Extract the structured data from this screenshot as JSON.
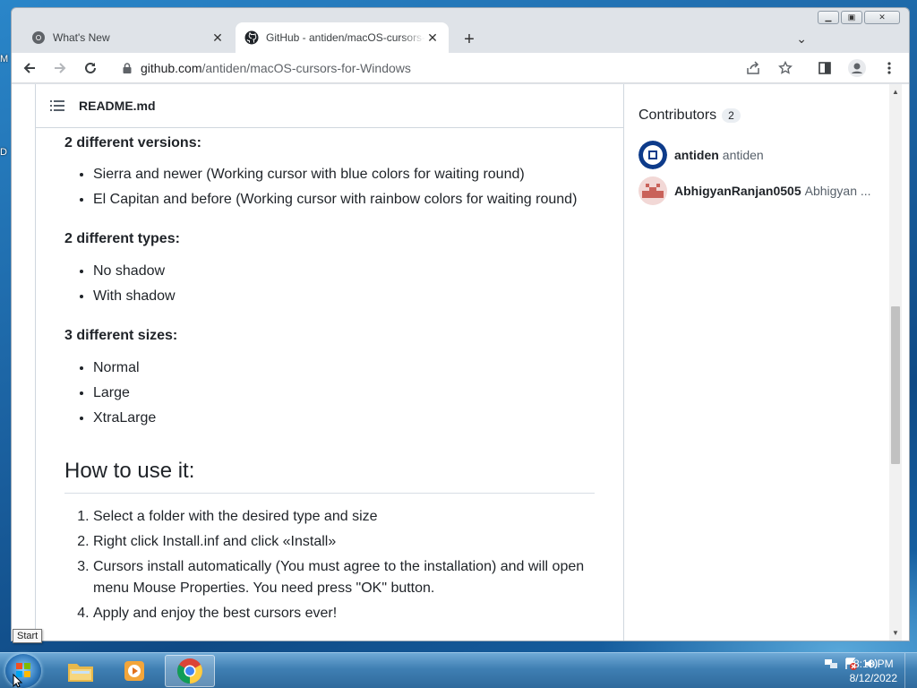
{
  "desktop": {
    "label_top": "M",
    "label_mid": "D"
  },
  "browser": {
    "tabs": [
      {
        "title": "What's New",
        "icon": "chrome-icon",
        "active": false
      },
      {
        "title": "GitHub - antiden/macOS-cursors-for-Windows",
        "icon": "github-icon",
        "active": true
      }
    ],
    "close_glyph": "✕",
    "new_tab_glyph": "+",
    "tab_list_glyph": "⌄",
    "url_host": "github.com",
    "url_path": "/antiden/macOS-cursors-for-Windows",
    "caption": {
      "minimize": "▁",
      "maximize": "▣",
      "close": "✕"
    }
  },
  "readme": {
    "filename": "README.md",
    "versions_heading": "2 different versions:",
    "versions": [
      "Sierra and newer (Working cursor with blue colors for waiting round)",
      "El Capitan and before (Working cursor with rainbow colors for waiting round)"
    ],
    "types_heading": "2 different types:",
    "types": [
      "No shadow",
      "With shadow"
    ],
    "sizes_heading": "3 different sizes:",
    "sizes": [
      "Normal",
      "Large",
      "XtraLarge"
    ],
    "howto_heading": "How to use it:",
    "steps": [
      "Select a folder with the desired type and size",
      "Right click Install.inf and click «Install»",
      "Cursors install automatically (You must agree to the installation) and will open menu Mouse Properties. You need press \"OK\" button.",
      "Apply and enjoy the best cursors ever!"
    ]
  },
  "sidebar": {
    "contributors_title": "Contributors",
    "contributors_count": "2",
    "contributors": [
      {
        "login": "antiden",
        "name": "antiden"
      },
      {
        "login": "AbhigyanRanjan0505",
        "name": "Abhigyan ..."
      }
    ]
  },
  "taskbar": {
    "start_tooltip": "Start",
    "time": "8:13 PM",
    "date": "8/12/2022"
  }
}
